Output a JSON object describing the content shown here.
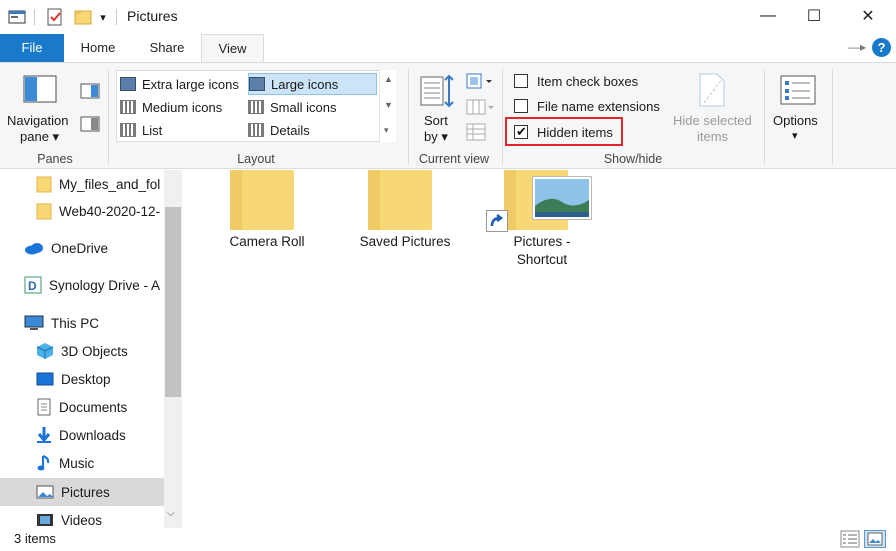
{
  "window": {
    "title": "Pictures",
    "minimize": "—",
    "maximize": "☐",
    "close": "✕"
  },
  "quick_access": {
    "dropdown": "▾"
  },
  "tabs": [
    {
      "label": "File"
    },
    {
      "label": "Home"
    },
    {
      "label": "Share"
    },
    {
      "label": "View"
    }
  ],
  "ribbon": {
    "panes": {
      "navigation_pane_line1": "Navigation",
      "navigation_pane_line2": "pane ▾",
      "group_label": "Panes"
    },
    "layout": {
      "items": [
        {
          "label": "Extra large icons"
        },
        {
          "label": "Large icons"
        },
        {
          "label": "Medium icons"
        },
        {
          "label": "Small icons"
        },
        {
          "label": "List"
        },
        {
          "label": "Details"
        }
      ],
      "group_label": "Layout"
    },
    "current_view": {
      "sort_by_line1": "Sort",
      "sort_by_line2": "by ▾",
      "group_label": "Current view"
    },
    "show_hide": {
      "item_check_boxes": {
        "label": "Item check boxes",
        "checked": false
      },
      "file_name_extensions": {
        "label": "File name extensions",
        "checked": false
      },
      "hidden_items": {
        "label": "Hidden items",
        "checked": true
      },
      "hide_selected_line1": "Hide selected",
      "hide_selected_line2": "items",
      "group_label": "Show/hide"
    },
    "options": {
      "label": "Options",
      "arrow": "▾"
    }
  },
  "nav": {
    "items": [
      {
        "label": "My_files_and_fol",
        "icon": "folder-icon"
      },
      {
        "label": "Web40-2020-12-",
        "icon": "folder-icon"
      },
      {
        "label": "OneDrive",
        "icon": "onedrive-icon"
      },
      {
        "label": "Synology Drive - A",
        "icon": "synology-drive-icon"
      },
      {
        "label": "This PC",
        "icon": "this-pc-icon"
      },
      {
        "label": "3D Objects",
        "icon": "3d-objects-icon"
      },
      {
        "label": "Desktop",
        "icon": "desktop-icon"
      },
      {
        "label": "Documents",
        "icon": "documents-icon"
      },
      {
        "label": "Downloads",
        "icon": "downloads-icon"
      },
      {
        "label": "Music",
        "icon": "music-icon"
      },
      {
        "label": "Pictures",
        "icon": "pictures-icon"
      },
      {
        "label": "Videos",
        "icon": "videos-icon"
      }
    ]
  },
  "content": {
    "items": [
      {
        "label": "Camera Roll"
      },
      {
        "label": "Saved Pictures"
      },
      {
        "label_line1": "Pictures -",
        "label_line2": "Shortcut"
      }
    ]
  },
  "status": {
    "item_count": "3 items"
  },
  "colors": {
    "accent": "#1979ca",
    "highlight": "#e0242e",
    "folder": "#f8d775"
  }
}
